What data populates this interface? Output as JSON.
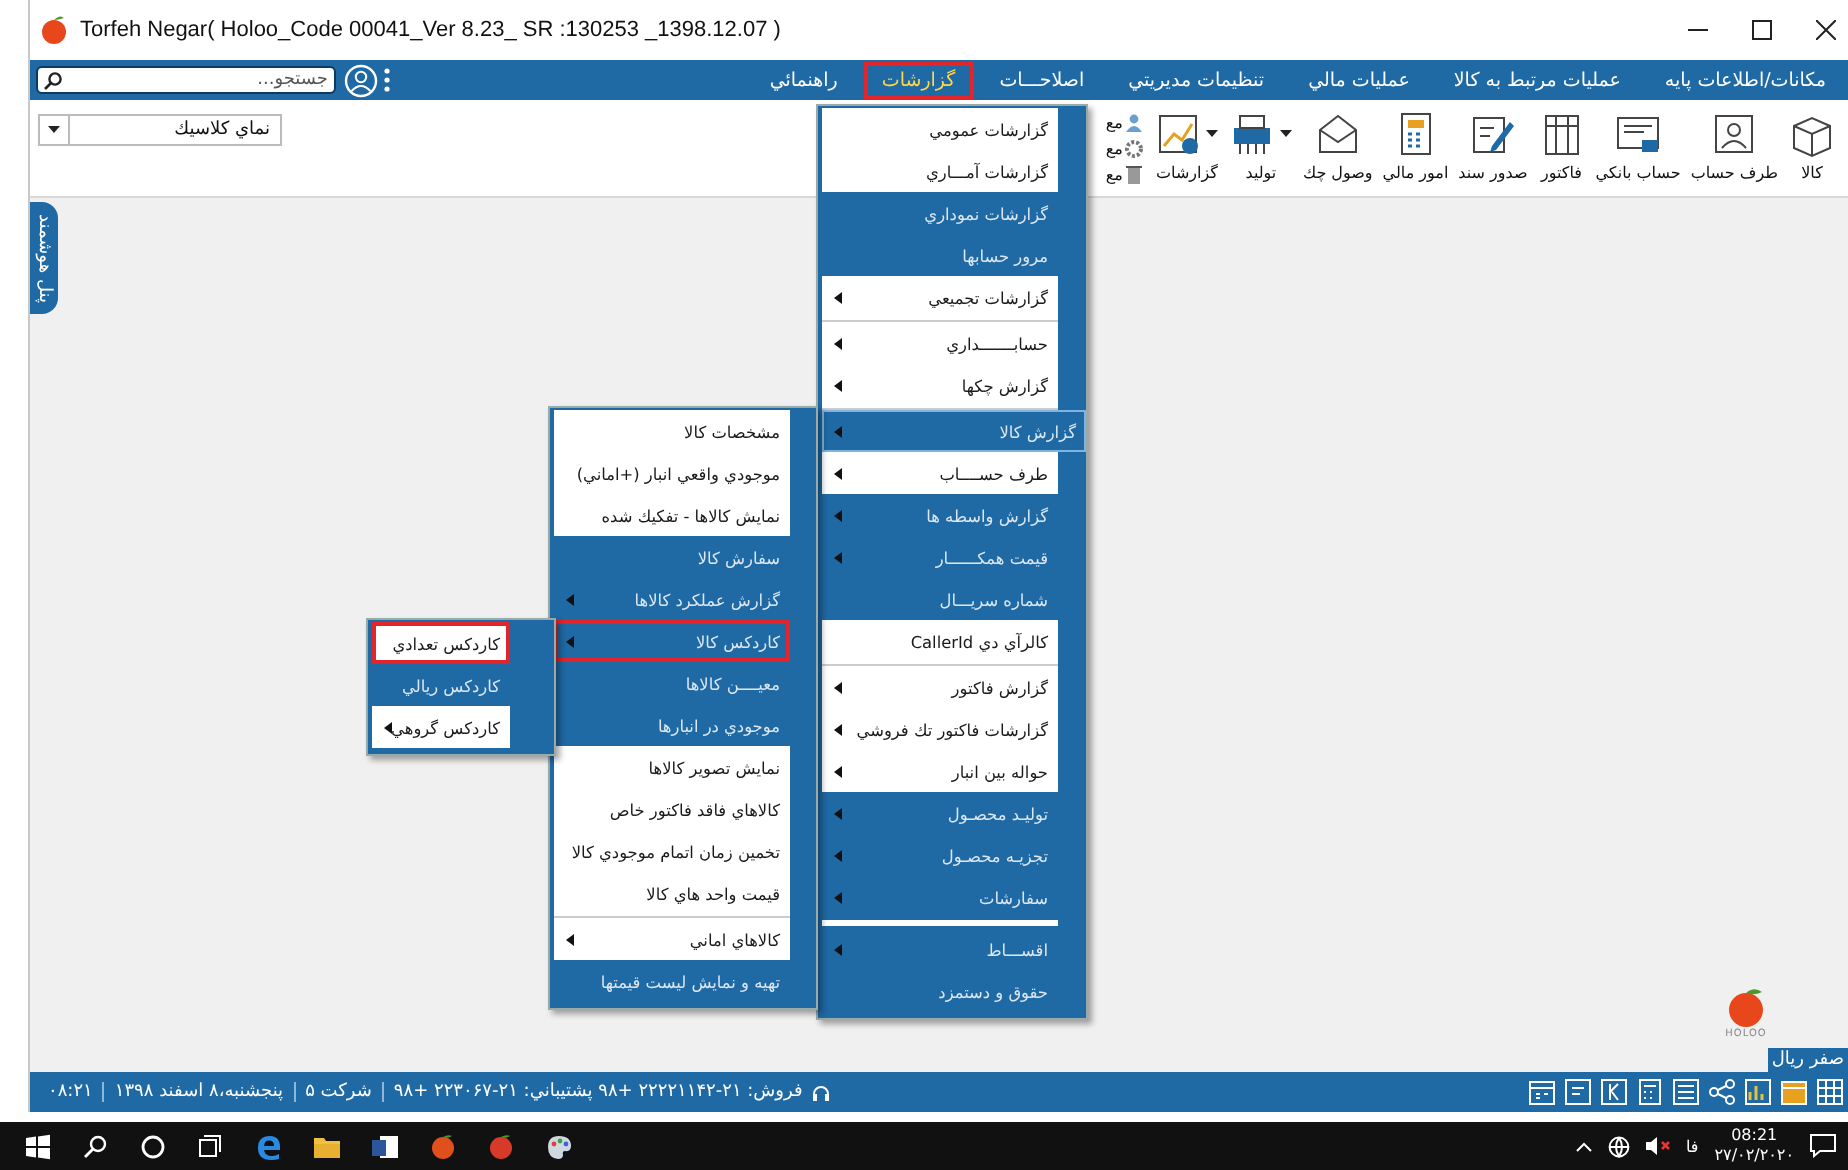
{
  "window": {
    "title": "Torfeh Negar( Holoo_Code 00041_Ver 8.23_ SR :130253 _1398.12.07 )"
  },
  "menu_bar": {
    "search": {
      "placeholder": "جستجو..."
    },
    "items": [
      {
        "label": "مكانات/اطلاعات پايه",
        "selected": false
      },
      {
        "label": "عمليات مرتبط به كالا",
        "selected": false
      },
      {
        "label": "عمليات مالي",
        "selected": false
      },
      {
        "label": "تنظيمات مديريتي",
        "selected": false
      },
      {
        "label": "اصلاحـــات",
        "selected": false
      },
      {
        "label": "گزارشات",
        "selected": true
      },
      {
        "label": "راهنمائي",
        "selected": false
      }
    ]
  },
  "toolbar": {
    "view_select": {
      "value": "نماي كلاسيك"
    },
    "buttons": [
      {
        "label": "كالا",
        "dropdown": false
      },
      {
        "label": "طرف حساب",
        "dropdown": false
      },
      {
        "label": "حساب بانكي",
        "dropdown": false
      },
      {
        "label": "فاكتور",
        "dropdown": false
      },
      {
        "label": "صدور سند",
        "dropdown": false
      },
      {
        "label": "امور مالي",
        "dropdown": false
      },
      {
        "label": "وصول چك",
        "dropdown": false
      },
      {
        "label": "توليد",
        "dropdown": true
      },
      {
        "label": "گزارشات",
        "dropdown": true
      }
    ],
    "partial_buttons": [
      {
        "label": "مع"
      },
      {
        "label": "مع"
      },
      {
        "label": "مع"
      }
    ]
  },
  "side_tab": {
    "label": "پنل هوشمند"
  },
  "logo": {
    "label": "HOLOO"
  },
  "balance_badge": {
    "label": "صفر ريال"
  },
  "menus": [
    {
      "items": [
        {
          "label": "گزارشات عمومي",
          "kind": "light",
          "submenu": false,
          "selected": false
        },
        {
          "label": "گزارشات آمـــاري",
          "kind": "light",
          "submenu": false,
          "selected": false
        },
        {
          "label": "گزارشات نموداري",
          "kind": "dark",
          "submenu": false,
          "selected": false
        },
        {
          "label": "مرور حسابها",
          "kind": "dark",
          "submenu": false,
          "selected": false
        },
        {
          "label": "گزارشات تجميعي",
          "kind": "light",
          "submenu": true,
          "selected": false,
          "separator_after": true
        },
        {
          "label": "حسابـــــــداري",
          "kind": "light",
          "submenu": true,
          "selected": false
        },
        {
          "label": "گزارش چكها",
          "kind": "light",
          "submenu": true,
          "selected": false,
          "separator_after": true
        },
        {
          "label": "گزارش كالا",
          "kind": "dark",
          "submenu": true,
          "selected": true
        },
        {
          "label": "طرف حســــاب",
          "kind": "light",
          "submenu": true,
          "selected": false
        },
        {
          "label": "گزارش واسطه ها",
          "kind": "dark",
          "submenu": true,
          "selected": false
        },
        {
          "label": "قيمت همكــــــار",
          "kind": "dark",
          "submenu": true,
          "selected": false
        },
        {
          "label": "شماره سريـــال",
          "kind": "dark",
          "submenu": false,
          "selected": false
        },
        {
          "label": "كالرآي دي CallerId",
          "kind": "light",
          "submenu": false,
          "selected": false,
          "separator_after": true
        },
        {
          "label": "گزارش فاكتور",
          "kind": "light",
          "submenu": true,
          "selected": false
        },
        {
          "label": "گزارشات فاكتور تك فروشي",
          "kind": "light",
          "submenu": true,
          "selected": false
        },
        {
          "label": "حواله بين انبار",
          "kind": "light",
          "submenu": true,
          "selected": false
        },
        {
          "label": "توليـد محصـول",
          "kind": "dark",
          "submenu": true,
          "selected": false
        },
        {
          "label": "تجزيـه محصـول",
          "kind": "dark",
          "submenu": true,
          "selected": false
        },
        {
          "label": "سفارشات",
          "kind": "dark",
          "submenu": true,
          "selected": false,
          "separator_after": true
        },
        {
          "label": "اقســـاط",
          "kind": "dark",
          "submenu": true,
          "selected": false
        },
        {
          "label": "حقوق و دستمزد",
          "kind": "dark",
          "submenu": false,
          "selected": false
        }
      ]
    },
    {
      "items": [
        {
          "label": "مشخصات كالا",
          "kind": "light",
          "submenu": false,
          "selected": false
        },
        {
          "label": "موجودي واقعي انبار (+اماني)",
          "kind": "light",
          "submenu": false,
          "selected": false
        },
        {
          "label": "نمايش كالاها - تفكيك شده",
          "kind": "light",
          "submenu": false,
          "selected": false
        },
        {
          "label": "سفارش كالا",
          "kind": "dark",
          "submenu": false,
          "selected": false
        },
        {
          "label": "گزارش عملكرد كالاها",
          "kind": "dark",
          "submenu": true,
          "selected": false
        },
        {
          "label": "كاردكس كالا",
          "kind": "dark",
          "submenu": true,
          "selected": true
        },
        {
          "label": "معيــــن كالاها",
          "kind": "dark",
          "submenu": false,
          "selected": false
        },
        {
          "label": "موجودي در انبارها",
          "kind": "dark",
          "submenu": false,
          "selected": false
        },
        {
          "label": "نمايش تصوير كالاها",
          "kind": "light",
          "submenu": false,
          "selected": false
        },
        {
          "label": "كالاهاي فاقد فاكتور خاص",
          "kind": "light",
          "submenu": false,
          "selected": false
        },
        {
          "label": "تخمين زمان اتمام موجودي كالا",
          "kind": "light",
          "submenu": false,
          "selected": false
        },
        {
          "label": "قيمت واحد هاي كالا",
          "kind": "light",
          "submenu": false,
          "selected": false,
          "separator_after": true
        },
        {
          "label": "كالاهاي اماني",
          "kind": "light",
          "submenu": true,
          "selected": false
        },
        {
          "label": "تهيه و نمايش ليست قيمتها",
          "kind": "dark",
          "submenu": false,
          "selected": false
        }
      ]
    },
    {
      "items": [
        {
          "label": "كاردكس تعدادي",
          "kind": "light",
          "submenu": false,
          "selected": true
        },
        {
          "label": "كاردكس ريالي",
          "kind": "dark",
          "submenu": false,
          "selected": false
        },
        {
          "label": "كاردكس گروهي",
          "kind": "light",
          "submenu": true,
          "selected": false
        }
      ]
    }
  ],
  "status_bar": {
    "time": "۰۸:۲۱",
    "date": "پنجشنبه،۸ اسفند ۱۳۹۸",
    "company": "شركت ۵",
    "contact": "فروش: ۲۱-۲۲۲۲۱۱۴۲ +۹۸ پشتيباني: ۲۱-۲۲۳۰۶۷ +۹۸"
  },
  "taskbar": {
    "language": "فا",
    "time": "08:21",
    "date": "۲۷/۰۲/۲۰۲۰"
  }
}
